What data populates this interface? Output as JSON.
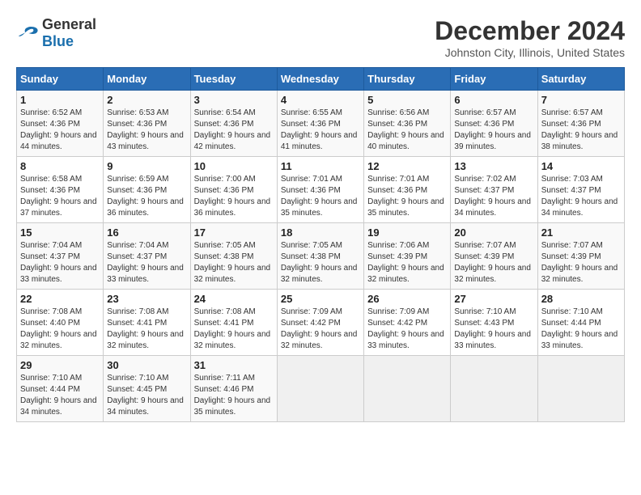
{
  "logo": {
    "general": "General",
    "blue": "Blue"
  },
  "title": "December 2024",
  "subtitle": "Johnston City, Illinois, United States",
  "days_header": [
    "Sunday",
    "Monday",
    "Tuesday",
    "Wednesday",
    "Thursday",
    "Friday",
    "Saturday"
  ],
  "weeks": [
    [
      {
        "day": "1",
        "sunrise": "Sunrise: 6:52 AM",
        "sunset": "Sunset: 4:36 PM",
        "daylight": "Daylight: 9 hours and 44 minutes."
      },
      {
        "day": "2",
        "sunrise": "Sunrise: 6:53 AM",
        "sunset": "Sunset: 4:36 PM",
        "daylight": "Daylight: 9 hours and 43 minutes."
      },
      {
        "day": "3",
        "sunrise": "Sunrise: 6:54 AM",
        "sunset": "Sunset: 4:36 PM",
        "daylight": "Daylight: 9 hours and 42 minutes."
      },
      {
        "day": "4",
        "sunrise": "Sunrise: 6:55 AM",
        "sunset": "Sunset: 4:36 PM",
        "daylight": "Daylight: 9 hours and 41 minutes."
      },
      {
        "day": "5",
        "sunrise": "Sunrise: 6:56 AM",
        "sunset": "Sunset: 4:36 PM",
        "daylight": "Daylight: 9 hours and 40 minutes."
      },
      {
        "day": "6",
        "sunrise": "Sunrise: 6:57 AM",
        "sunset": "Sunset: 4:36 PM",
        "daylight": "Daylight: 9 hours and 39 minutes."
      },
      {
        "day": "7",
        "sunrise": "Sunrise: 6:57 AM",
        "sunset": "Sunset: 4:36 PM",
        "daylight": "Daylight: 9 hours and 38 minutes."
      }
    ],
    [
      {
        "day": "8",
        "sunrise": "Sunrise: 6:58 AM",
        "sunset": "Sunset: 4:36 PM",
        "daylight": "Daylight: 9 hours and 37 minutes."
      },
      {
        "day": "9",
        "sunrise": "Sunrise: 6:59 AM",
        "sunset": "Sunset: 4:36 PM",
        "daylight": "Daylight: 9 hours and 36 minutes."
      },
      {
        "day": "10",
        "sunrise": "Sunrise: 7:00 AM",
        "sunset": "Sunset: 4:36 PM",
        "daylight": "Daylight: 9 hours and 36 minutes."
      },
      {
        "day": "11",
        "sunrise": "Sunrise: 7:01 AM",
        "sunset": "Sunset: 4:36 PM",
        "daylight": "Daylight: 9 hours and 35 minutes."
      },
      {
        "day": "12",
        "sunrise": "Sunrise: 7:01 AM",
        "sunset": "Sunset: 4:36 PM",
        "daylight": "Daylight: 9 hours and 35 minutes."
      },
      {
        "day": "13",
        "sunrise": "Sunrise: 7:02 AM",
        "sunset": "Sunset: 4:37 PM",
        "daylight": "Daylight: 9 hours and 34 minutes."
      },
      {
        "day": "14",
        "sunrise": "Sunrise: 7:03 AM",
        "sunset": "Sunset: 4:37 PM",
        "daylight": "Daylight: 9 hours and 34 minutes."
      }
    ],
    [
      {
        "day": "15",
        "sunrise": "Sunrise: 7:04 AM",
        "sunset": "Sunset: 4:37 PM",
        "daylight": "Daylight: 9 hours and 33 minutes."
      },
      {
        "day": "16",
        "sunrise": "Sunrise: 7:04 AM",
        "sunset": "Sunset: 4:37 PM",
        "daylight": "Daylight: 9 hours and 33 minutes."
      },
      {
        "day": "17",
        "sunrise": "Sunrise: 7:05 AM",
        "sunset": "Sunset: 4:38 PM",
        "daylight": "Daylight: 9 hours and 32 minutes."
      },
      {
        "day": "18",
        "sunrise": "Sunrise: 7:05 AM",
        "sunset": "Sunset: 4:38 PM",
        "daylight": "Daylight: 9 hours and 32 minutes."
      },
      {
        "day": "19",
        "sunrise": "Sunrise: 7:06 AM",
        "sunset": "Sunset: 4:39 PM",
        "daylight": "Daylight: 9 hours and 32 minutes."
      },
      {
        "day": "20",
        "sunrise": "Sunrise: 7:07 AM",
        "sunset": "Sunset: 4:39 PM",
        "daylight": "Daylight: 9 hours and 32 minutes."
      },
      {
        "day": "21",
        "sunrise": "Sunrise: 7:07 AM",
        "sunset": "Sunset: 4:39 PM",
        "daylight": "Daylight: 9 hours and 32 minutes."
      }
    ],
    [
      {
        "day": "22",
        "sunrise": "Sunrise: 7:08 AM",
        "sunset": "Sunset: 4:40 PM",
        "daylight": "Daylight: 9 hours and 32 minutes."
      },
      {
        "day": "23",
        "sunrise": "Sunrise: 7:08 AM",
        "sunset": "Sunset: 4:41 PM",
        "daylight": "Daylight: 9 hours and 32 minutes."
      },
      {
        "day": "24",
        "sunrise": "Sunrise: 7:08 AM",
        "sunset": "Sunset: 4:41 PM",
        "daylight": "Daylight: 9 hours and 32 minutes."
      },
      {
        "day": "25",
        "sunrise": "Sunrise: 7:09 AM",
        "sunset": "Sunset: 4:42 PM",
        "daylight": "Daylight: 9 hours and 32 minutes."
      },
      {
        "day": "26",
        "sunrise": "Sunrise: 7:09 AM",
        "sunset": "Sunset: 4:42 PM",
        "daylight": "Daylight: 9 hours and 33 minutes."
      },
      {
        "day": "27",
        "sunrise": "Sunrise: 7:10 AM",
        "sunset": "Sunset: 4:43 PM",
        "daylight": "Daylight: 9 hours and 33 minutes."
      },
      {
        "day": "28",
        "sunrise": "Sunrise: 7:10 AM",
        "sunset": "Sunset: 4:44 PM",
        "daylight": "Daylight: 9 hours and 33 minutes."
      }
    ],
    [
      {
        "day": "29",
        "sunrise": "Sunrise: 7:10 AM",
        "sunset": "Sunset: 4:44 PM",
        "daylight": "Daylight: 9 hours and 34 minutes."
      },
      {
        "day": "30",
        "sunrise": "Sunrise: 7:10 AM",
        "sunset": "Sunset: 4:45 PM",
        "daylight": "Daylight: 9 hours and 34 minutes."
      },
      {
        "day": "31",
        "sunrise": "Sunrise: 7:11 AM",
        "sunset": "Sunset: 4:46 PM",
        "daylight": "Daylight: 9 hours and 35 minutes."
      },
      null,
      null,
      null,
      null
    ]
  ]
}
